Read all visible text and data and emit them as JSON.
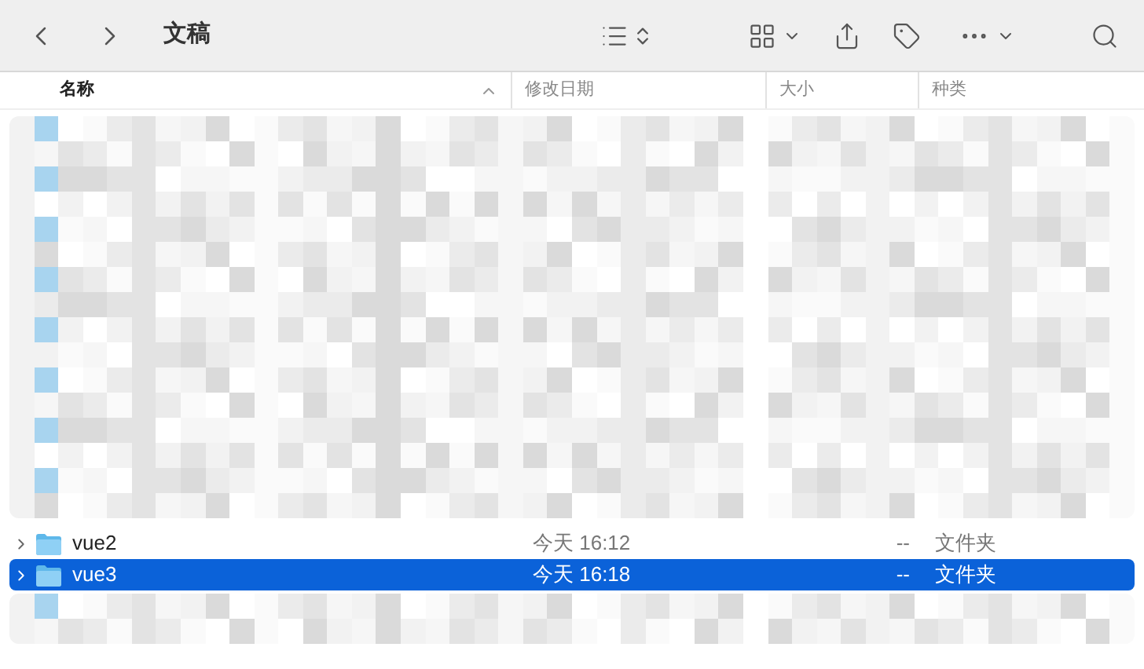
{
  "window": {
    "title": "文稿"
  },
  "table": {
    "columns": [
      {
        "label": "名称",
        "sorted": true
      },
      {
        "label": "修改日期",
        "sorted": false
      },
      {
        "label": "大小",
        "sorted": false
      },
      {
        "label": "种类",
        "sorted": false
      }
    ],
    "rows": [
      {
        "name": "vue2",
        "date": "今天 16:12",
        "size": "--",
        "kind": "文件夹",
        "selected": false
      },
      {
        "name": "vue3",
        "date": "今天 16:18",
        "size": "--",
        "kind": "文件夹",
        "selected": true
      }
    ]
  }
}
